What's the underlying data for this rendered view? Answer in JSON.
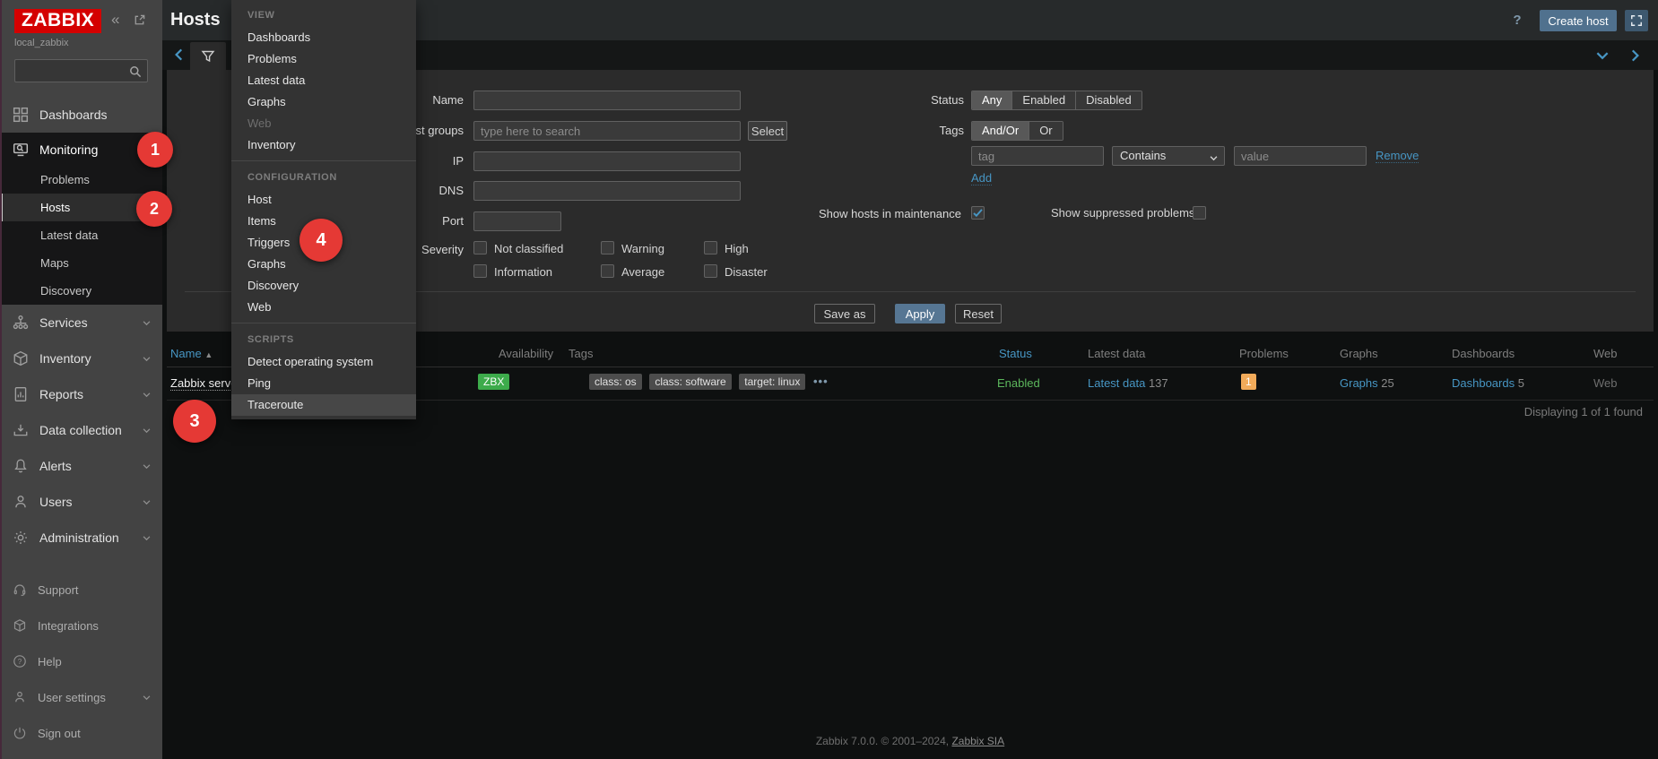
{
  "app": {
    "logo": "ZABBIX",
    "server": "local_zabbix",
    "footer_text": "Zabbix 7.0.0. © 2001–2024, ",
    "footer_link": "Zabbix SIA"
  },
  "header": {
    "title": "Hosts",
    "help": "?",
    "create_host": "Create host"
  },
  "sidebar": {
    "main_menu": [
      {
        "label": "Dashboards"
      },
      {
        "label": "Monitoring"
      },
      {
        "label": "Services"
      },
      {
        "label": "Inventory"
      },
      {
        "label": "Reports"
      },
      {
        "label": "Data collection"
      },
      {
        "label": "Alerts"
      },
      {
        "label": "Users"
      },
      {
        "label": "Administration"
      }
    ],
    "monitoring_submenu": [
      {
        "label": "Problems"
      },
      {
        "label": "Hosts"
      },
      {
        "label": "Latest data"
      },
      {
        "label": "Maps"
      },
      {
        "label": "Discovery"
      }
    ],
    "footer_menu": [
      {
        "label": "Support"
      },
      {
        "label": "Integrations"
      },
      {
        "label": "Help"
      },
      {
        "label": "User settings"
      },
      {
        "label": "Sign out"
      }
    ]
  },
  "context_menu": {
    "sections": [
      {
        "title": "VIEW",
        "items": [
          {
            "label": "Dashboards"
          },
          {
            "label": "Problems"
          },
          {
            "label": "Latest data"
          },
          {
            "label": "Graphs"
          },
          {
            "label": "Web",
            "disabled": true
          },
          {
            "label": "Inventory"
          }
        ]
      },
      {
        "title": "CONFIGURATION",
        "items": [
          {
            "label": "Host"
          },
          {
            "label": "Items"
          },
          {
            "label": "Triggers"
          },
          {
            "label": "Graphs"
          },
          {
            "label": "Discovery"
          },
          {
            "label": "Web"
          }
        ]
      },
      {
        "title": "SCRIPTS",
        "items": [
          {
            "label": "Detect operating system"
          },
          {
            "label": "Ping"
          },
          {
            "label": "Traceroute",
            "hover": true
          }
        ]
      }
    ]
  },
  "filter": {
    "name_label": "Name",
    "host_groups_label": "Host groups",
    "host_groups_placeholder": "type here to search",
    "select_button": "Select",
    "ip_label": "IP",
    "dns_label": "DNS",
    "port_label": "Port",
    "severity_label": "Severity",
    "severity_options": [
      "Not classified",
      "Information",
      "Warning",
      "Average",
      "High",
      "Disaster"
    ],
    "status_label": "Status",
    "status_options": [
      "Any",
      "Enabled",
      "Disabled"
    ],
    "status_selected": "Any",
    "tags_label": "Tags",
    "tags_operators": [
      "And/Or",
      "Or"
    ],
    "tags_operator_selected": "And/Or",
    "tag_placeholder": "tag",
    "tag_operator": "Contains",
    "value_placeholder": "value",
    "remove_link": "Remove",
    "add_link": "Add",
    "maintenance_label": "Show hosts in maintenance",
    "maintenance_checked": true,
    "suppressed_label": "Show suppressed problems",
    "suppressed_checked": false,
    "save_as_button": "Save as",
    "apply_button": "Apply",
    "reset_button": "Reset"
  },
  "table": {
    "columns": [
      "Name",
      "Availability",
      "Tags",
      "Status",
      "Latest data",
      "Problems",
      "Graphs",
      "Dashboards",
      "Web"
    ],
    "sort_arrow": "▲",
    "row": {
      "name": "Zabbix server",
      "availability": "ZBX",
      "tags": [
        "class: os",
        "class: software",
        "target: linux"
      ],
      "more": "•••",
      "status": "Enabled",
      "latest_data_link": "Latest data",
      "latest_data_count": "137",
      "problems_count": "1",
      "graphs_link": "Graphs",
      "graphs_count": "25",
      "dashboards_link": "Dashboards",
      "dashboards_count": "5",
      "web": "Web"
    },
    "summary": "Displaying 1 of 1 found"
  },
  "annotations": [
    {
      "n": "1"
    },
    {
      "n": "2"
    },
    {
      "n": "3"
    },
    {
      "n": "4"
    }
  ],
  "colors": {
    "logo_red": "#d40000",
    "annotation_red": "#e53935",
    "link_blue": "#4796c4",
    "enabled_green": "#5cb75c",
    "zbx_badge_green": "#3dab4b",
    "problem_badge_orange": "#f2ab5a"
  }
}
